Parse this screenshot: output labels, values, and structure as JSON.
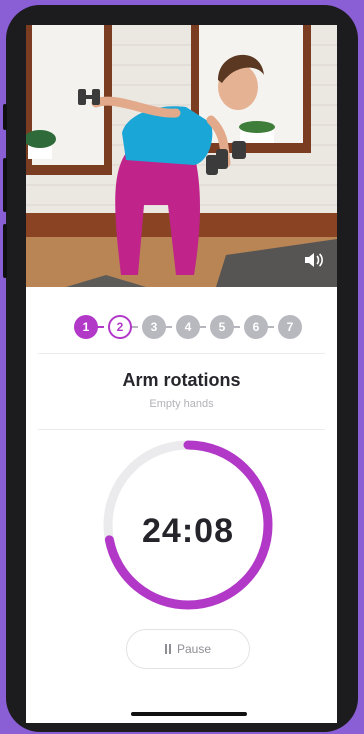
{
  "video": {
    "volume_icon": "speaker-icon"
  },
  "steps": {
    "items": [
      {
        "label": "1",
        "state": "done"
      },
      {
        "label": "2",
        "state": "current"
      },
      {
        "label": "3",
        "state": "todo"
      },
      {
        "label": "4",
        "state": "todo"
      },
      {
        "label": "5",
        "state": "todo"
      },
      {
        "label": "6",
        "state": "todo"
      },
      {
        "label": "7",
        "state": "todo"
      }
    ]
  },
  "exercise": {
    "title": "Arm rotations",
    "subtitle": "Empty hands"
  },
  "timer": {
    "value": "24:08",
    "progress": 0.72
  },
  "controls": {
    "pause_label": "Pause"
  },
  "colors": {
    "accent": "#b238c8",
    "track": "#ebebee",
    "background": "#8a5fd6"
  }
}
